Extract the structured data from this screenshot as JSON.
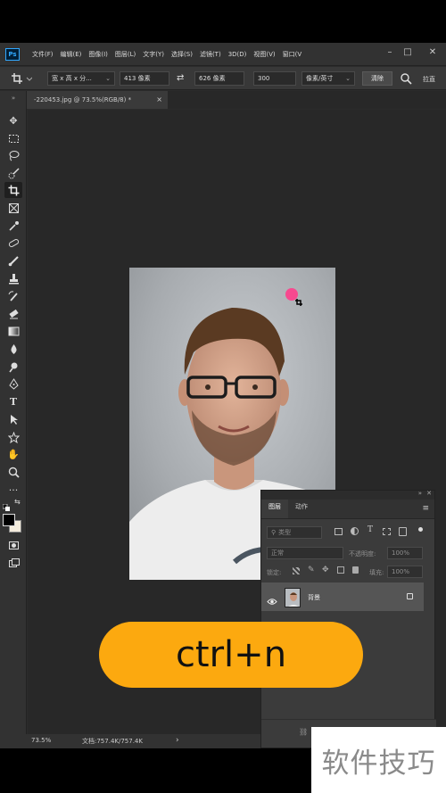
{
  "app": {
    "logo": "Ps",
    "menu": [
      "文件(F)",
      "编辑(E)",
      "图像(I)",
      "图层(L)",
      "文字(Y)",
      "选择(S)",
      "滤镜(T)",
      "3D(D)",
      "视图(V)",
      "窗口(V"
    ]
  },
  "options": {
    "ratio_select": "宽 x 高 x 分...",
    "width_value": "413 像素",
    "height_value": "626 像素",
    "resolution_value": "300",
    "unit_select": "像素/英寸",
    "clear_button": "清除",
    "straighten_label": "拉直"
  },
  "document": {
    "tab_title": "-220453.jpg @ 73.5%(RGB/8) *",
    "close_glyph": "×"
  },
  "layers_panel": {
    "tab_layers": "图层",
    "tab_actions": "动作",
    "search_placeholder": "类型",
    "blend_mode": "正常",
    "opacity_label": "不透明度:",
    "opacity_value": "100%",
    "lock_label": "锁定:",
    "fill_label": "填充:",
    "fill_value": "100%",
    "layer_name": "背景"
  },
  "status": {
    "zoom": "73.5%",
    "doc_info": "文档:757.4K/757.4K",
    "arrow": "›"
  },
  "overlay": {
    "shortcut_text": "ctrl+n",
    "watermark": "软件技巧"
  },
  "colors": {
    "accent_orange": "#fca90f",
    "ps_blue": "#31a8ff",
    "cursor_pink": "#ff3d8b"
  }
}
